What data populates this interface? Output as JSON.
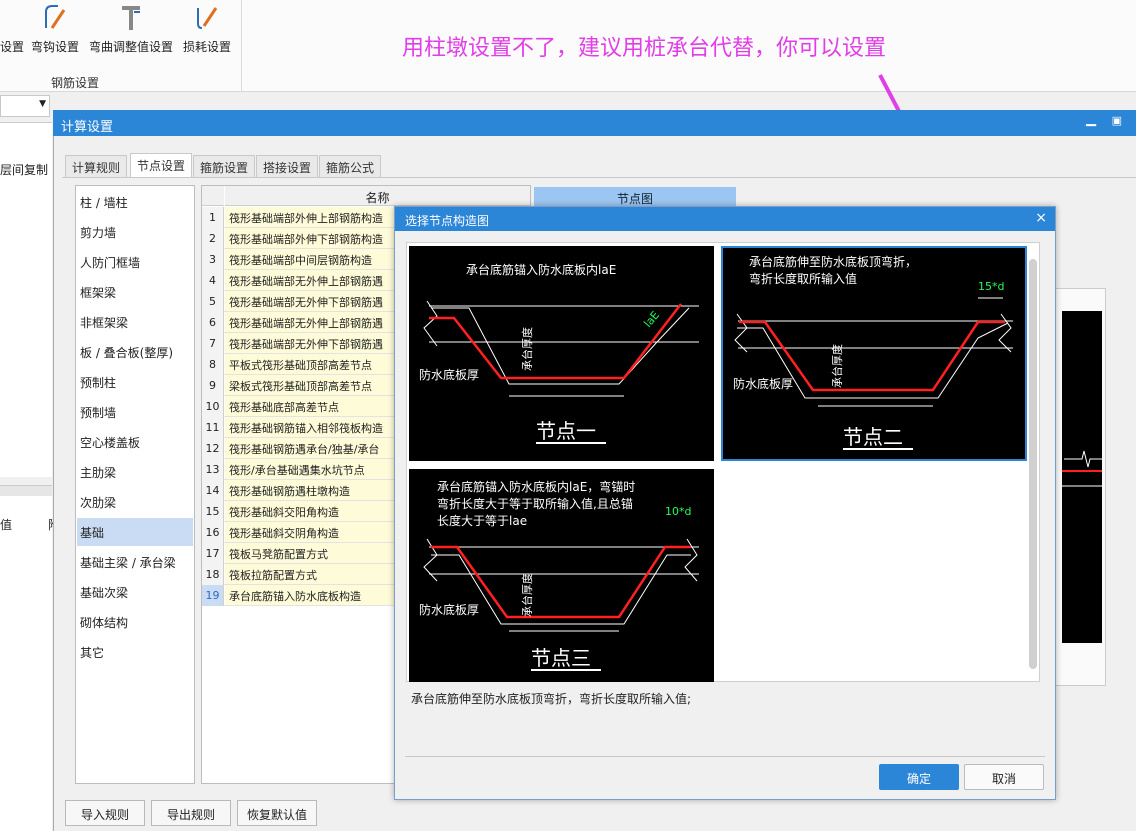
{
  "ribbon": {
    "buttons": [
      "设置",
      "弯钩设置",
      "弯曲调整值设置",
      "损耗设置"
    ],
    "group_label": "钢筋设置"
  },
  "annotation": "用柱墩设置不了，建议用桩承台代替，你可以设置",
  "left_bg": {
    "label1": "层间复制",
    "label2": "值",
    "label3": "附"
  },
  "window": {
    "title": "计算设置",
    "tabs": [
      "计算规则",
      "节点设置",
      "箍筋设置",
      "搭接设置",
      "箍筋公式"
    ],
    "active_tab": "节点设置",
    "categories": [
      "柱 / 墙柱",
      "剪力墙",
      "人防门框墙",
      "框架梁",
      "非框架梁",
      "板 / 叠合板(整厚)",
      "预制柱",
      "预制墙",
      "空心楼盖板",
      "主肋梁",
      "次肋梁",
      "基础",
      "基础主梁 / 承台梁",
      "基础次梁",
      "砌体结构",
      "其它"
    ],
    "selected_category": "基础",
    "grid_headers": {
      "name": "名称",
      "node_image": "节点图"
    },
    "rows": [
      {
        "n": "1",
        "name": "筏形基础端部外伸上部钢筋构造"
      },
      {
        "n": "2",
        "name": "筏形基础端部外伸下部钢筋构造"
      },
      {
        "n": "3",
        "name": "筏形基础端部中间层钢筋构造"
      },
      {
        "n": "4",
        "name": "筏形基础端部无外伸上部钢筋遇"
      },
      {
        "n": "5",
        "name": "筏形基础端部无外伸下部钢筋遇"
      },
      {
        "n": "6",
        "name": "筏形基础端部无外伸上部钢筋遇"
      },
      {
        "n": "7",
        "name": "筏形基础端部无外伸下部钢筋遇"
      },
      {
        "n": "8",
        "name": "平板式筏形基础顶部高差节点"
      },
      {
        "n": "9",
        "name": "梁板式筏形基础顶部高差节点"
      },
      {
        "n": "10",
        "name": "筏形基础底部高差节点"
      },
      {
        "n": "11",
        "name": "筏形基础钢筋锚入相邻筏板构造"
      },
      {
        "n": "12",
        "name": "筏形基础钢筋遇承台/独基/承台"
      },
      {
        "n": "13",
        "name": "筏形/承台基础遇集水坑节点"
      },
      {
        "n": "14",
        "name": "筏形基础钢筋遇柱墩构造"
      },
      {
        "n": "15",
        "name": "筏形基础斜交阳角构造"
      },
      {
        "n": "16",
        "name": "筏形基础斜交阴角构造"
      },
      {
        "n": "17",
        "name": "筏板马凳筋配置方式"
      },
      {
        "n": "18",
        "name": "筏板拉筋配置方式"
      },
      {
        "n": "19",
        "name": "承台底筋锚入防水底板构造"
      }
    ],
    "selected_row": "19",
    "bottom_buttons": [
      "导入规则",
      "导出规则",
      "恢复默认值"
    ]
  },
  "dialog": {
    "title": "选择节点构造图",
    "panels": [
      {
        "caption": "节点一",
        "text_lines": [
          "承台底筋锚入防水底板内laE"
        ],
        "side_label": "防水底板厚",
        "vert_label": "承台厚度",
        "dim_label": "laE"
      },
      {
        "caption": "节点二",
        "text_lines": [
          "承台底筋伸至防水底板顶弯折，",
          "弯折长度取所输入值"
        ],
        "side_label": "防水底板厚",
        "vert_label": "承台厚度",
        "dim_label": "15*d"
      },
      {
        "caption": "节点三",
        "text_lines": [
          "承台底筋锚入防水底板内laE，弯锚时",
          "弯折长度大于等于取所输入值,且总锚",
          "长度大于等于lae"
        ],
        "side_label": "防水底板厚",
        "vert_label": "承台厚度",
        "dim_label": "10*d"
      }
    ],
    "selected_panel": 2,
    "description": "承台底筋伸至防水底板顶弯折，弯折长度取所输入值;",
    "ok_label": "确定",
    "cancel_label": "取消",
    "close_glyph": "×"
  },
  "colors": {
    "accent": "#2c86d8",
    "annotation": "#e23ee8",
    "rebar": "#ff2020",
    "dim": "#00ff44"
  }
}
